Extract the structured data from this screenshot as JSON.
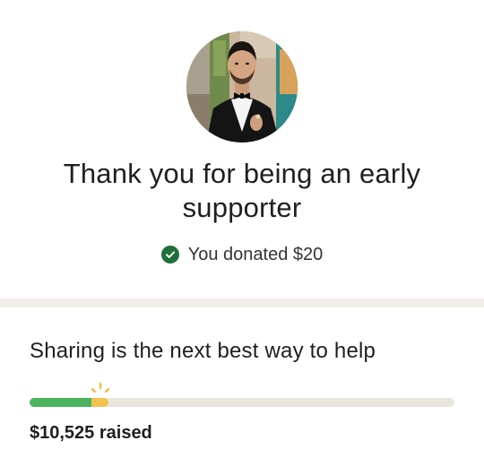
{
  "header": {
    "title": "Thank you for being an early supporter",
    "title_line1": "Thank you for being an early",
    "title_line2": "supporter"
  },
  "donation": {
    "icon": "check-circle-icon",
    "text": "You donated $20"
  },
  "share": {
    "heading": "Sharing is the next best way to help"
  },
  "progress": {
    "fraction_total": 0.185,
    "fraction_recent": 0.04,
    "raised_text": "$10,525 raised"
  },
  "colors": {
    "progress_green": "#4ab35e",
    "progress_recent": "#f2c24f",
    "track": "#e8e5dc",
    "check_green": "#1e6f3b",
    "divider": "#f1efe8"
  }
}
